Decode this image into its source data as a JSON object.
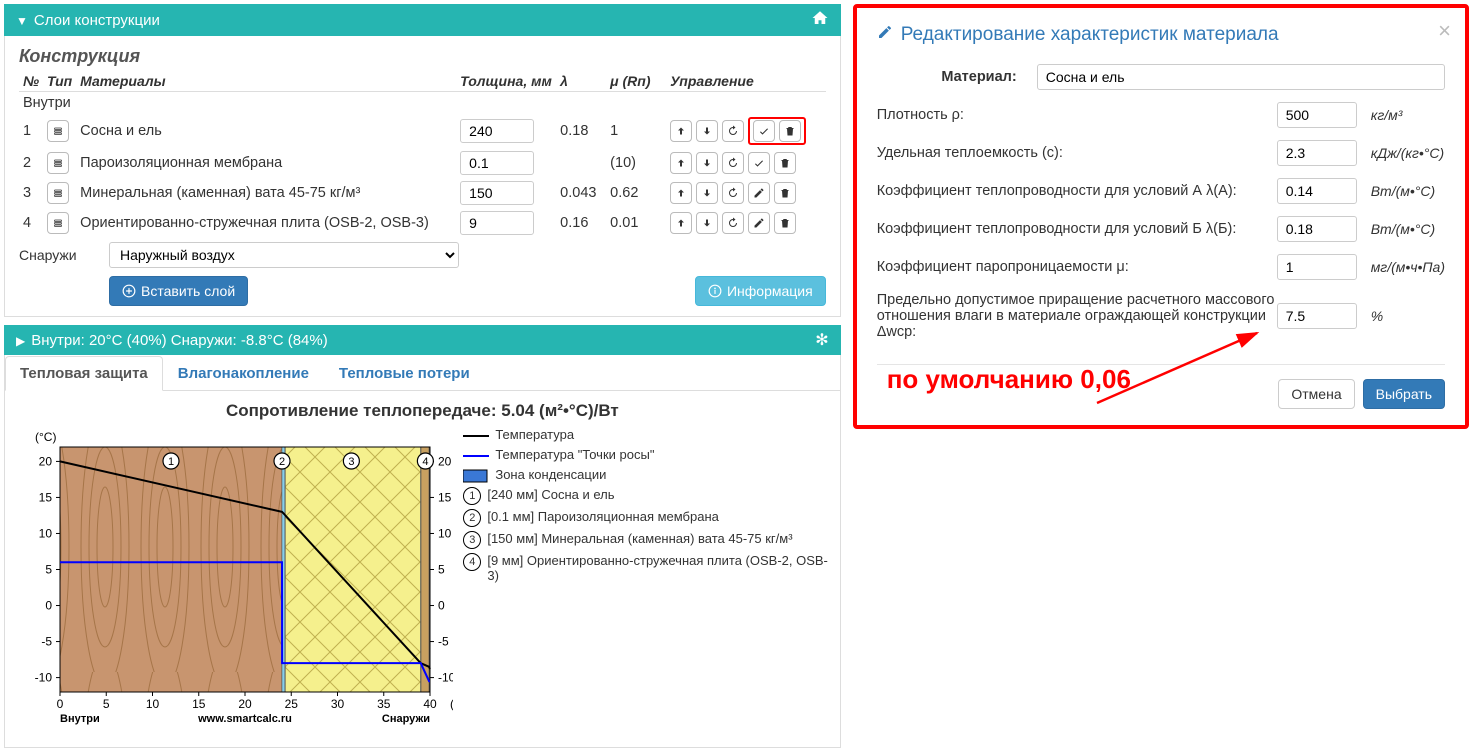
{
  "left": {
    "layers_heading": "Слои конструкции",
    "subtitle": "Конструкция",
    "headers": {
      "num": "№",
      "type": "Тип",
      "material": "Материалы",
      "thickness": "Толщина, мм",
      "lambda": "λ",
      "mu": "μ (Rп)",
      "controls": "Управление"
    },
    "inside_label": "Внутри",
    "outside_label": "Снаружи",
    "rows": [
      {
        "n": "1",
        "name": "Сосна и ель",
        "thk": "240",
        "lam": "0.18",
        "mu": "1",
        "edit_icon": "check"
      },
      {
        "n": "2",
        "name": "Пароизоляционная мембрана",
        "thk": "0.1",
        "lam": "",
        "mu": "(10)",
        "edit_icon": "check"
      },
      {
        "n": "3",
        "name": "Минеральная (каменная) вата 45-75 кг/м³",
        "thk": "150",
        "lam": "0.043",
        "mu": "0.62",
        "edit_icon": "pencil"
      },
      {
        "n": "4",
        "name": "Ориентированно-стружечная плита (OSB-2, OSB-3)",
        "thk": "9",
        "lam": "0.16",
        "mu": "0.01",
        "edit_icon": "pencil"
      }
    ],
    "outside_select": "Наружный воздух",
    "insert_btn": "Вставить слой",
    "info_btn": "Информация",
    "conditions_heading": "Внутри: 20°C (40%) Снаружи: -8.8°C (84%)",
    "tabs": {
      "thermal": "Тепловая защита",
      "moisture": "Влагонакопление",
      "loss": "Тепловые потери"
    },
    "chart": {
      "title": "Сопротивление теплопередаче: 5.04 (м²•°С)/Вт",
      "ylabel": "(°С)",
      "xlabel": "(см)",
      "inside": "Внутри",
      "source": "www.smartcalc.ru",
      "outside": "Снаружи",
      "legend": {
        "temp": "Температура",
        "dew": "Температура \"Точки росы\"",
        "cond": "Зона конденсации",
        "l1": "[240 мм] Сосна и ель",
        "l2": "[0.1 мм] Пароизоляционная мембрана",
        "l3": "[150 мм] Минеральная (каменная) вата 45-75 кг/м³",
        "l4": "[9 мм] Ориентированно-стружечная плита (OSB-2, OSB-3)"
      }
    }
  },
  "chart_data": {
    "type": "line",
    "xlabel": "(см)",
    "ylabel": "(°С)",
    "xlim": [
      0,
      40
    ],
    "ylim": [
      -12,
      22
    ],
    "xticks": [
      0,
      5,
      10,
      15,
      20,
      25,
      30,
      35,
      40
    ],
    "yticks": [
      -10,
      -5,
      0,
      5,
      10,
      15,
      20
    ],
    "layer_bounds_cm": [
      0,
      24,
      24.01,
      39.01,
      39.91
    ],
    "series": [
      {
        "name": "Температура",
        "color": "#000",
        "x": [
          0,
          24,
          24.01,
          39,
          39.9,
          40
        ],
        "y": [
          20,
          13,
          13,
          -8,
          -8.5,
          -8.8
        ]
      },
      {
        "name": "Температура \"Точки росы\"",
        "color": "#0000ff",
        "x": [
          0,
          24,
          24.01,
          39,
          39.9,
          40
        ],
        "y": [
          6,
          6,
          -8,
          -8,
          -10.5,
          -10.5
        ]
      }
    ],
    "condensation_zone_cm": null
  },
  "right": {
    "title": "Редактирование характеристик материала",
    "material_label": "Материал:",
    "material_value": "Сосна и ель",
    "fields": [
      {
        "label": "Плотность ρ:",
        "value": "500",
        "unit": "кг/м³"
      },
      {
        "label": "Удельная теплоемкость (c):",
        "value": "2.3",
        "unit": "кДж/(кг•°С)"
      },
      {
        "label": "Коэффициент теплопроводности для условий А λ(А):",
        "value": "0.14",
        "unit": "Вт/(м•°С)"
      },
      {
        "label": "Коэффициент теплопроводности для условий Б λ(Б):",
        "value": "0.18",
        "unit": "Вт/(м•°С)"
      },
      {
        "label": "Коэффициент паропроницаемости μ:",
        "value": "1",
        "unit": "мг/(м•ч•Па)"
      },
      {
        "label": "Предельно допустимое приращение расчетного массового отношения влаги в материале ограждающей конструкции Δwср:",
        "value": "7.5",
        "unit": "%"
      }
    ],
    "annot": "по умолчанию 0,06",
    "cancel": "Отмена",
    "ok": "Выбрать"
  }
}
